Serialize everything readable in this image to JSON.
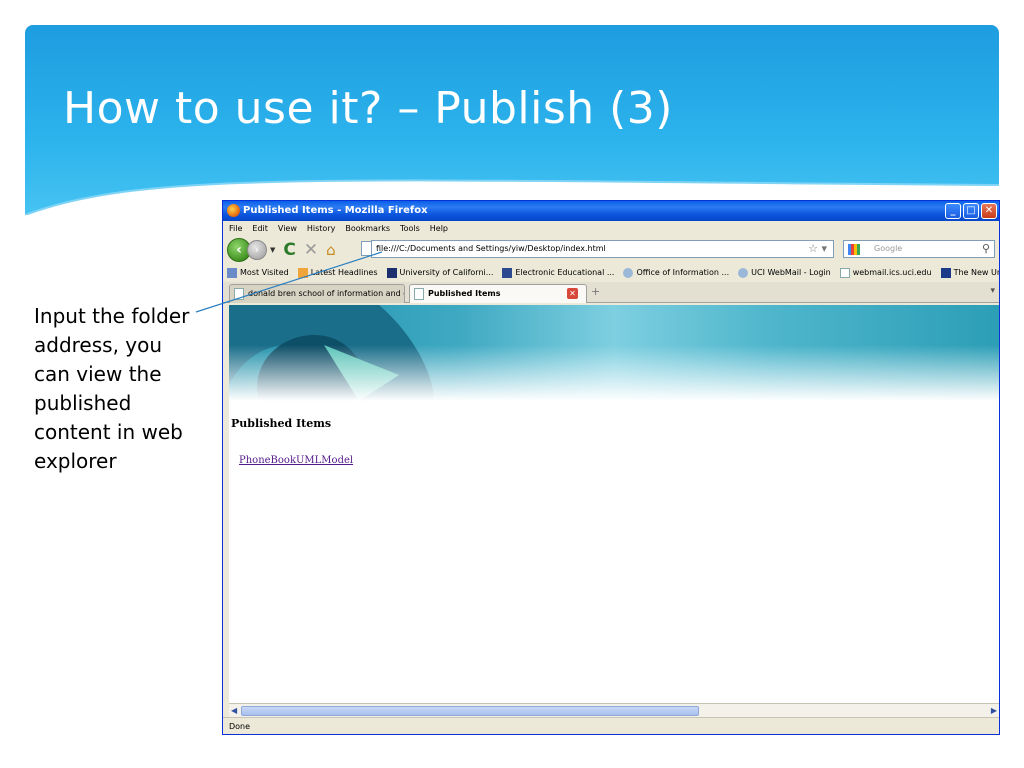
{
  "slide": {
    "title": "How to use it? – Publish (3)",
    "caption": "Input the folder address, you can view the published content in web explorer"
  },
  "window": {
    "title": "Published Items - Mozilla Firefox",
    "menu": [
      "File",
      "Edit",
      "View",
      "History",
      "Bookmarks",
      "Tools",
      "Help"
    ],
    "url": "file:///C:/Documents and Settings/yiw/Desktop/index.html",
    "search_placeholder": "Google",
    "bookmarks": [
      "Most Visited",
      "Latest Headlines",
      "University of Californi...",
      "Electronic Educational ...",
      "Office of Information ...",
      "UCI WebMail - Login",
      "webmail.ics.uci.edu",
      "The New University"
    ],
    "tabs": [
      {
        "label": "donald bren school of information and c..."
      },
      {
        "label": "Published Items"
      }
    ],
    "status": "Done"
  },
  "page": {
    "heading": "Published Items",
    "link": "PhoneBookUMLModel"
  },
  "colors": {
    "header_blue": "#1E9CE0",
    "xp_titlebar": "#0A5FE8",
    "visited_link": "#551A8B"
  }
}
